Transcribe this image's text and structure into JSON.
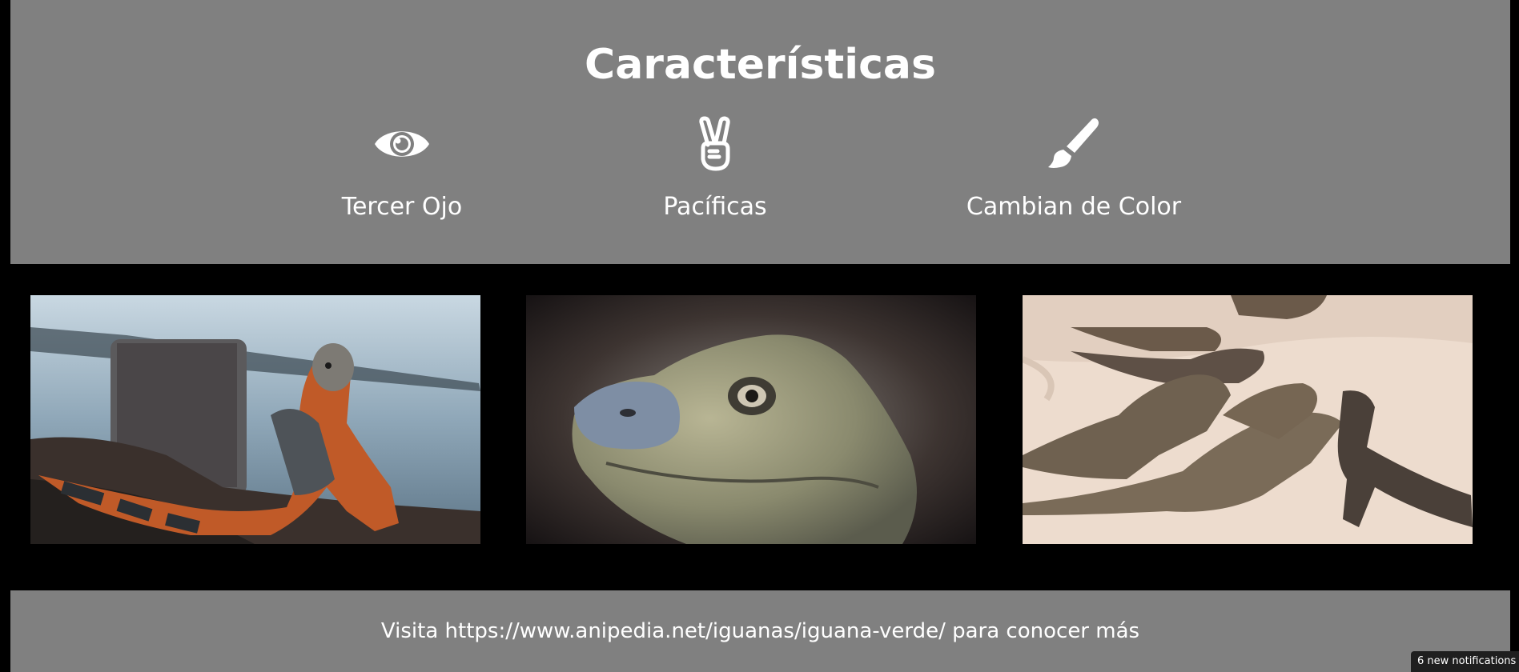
{
  "features": {
    "title": "Características",
    "items": [
      {
        "label": "Tercer Ojo",
        "icon": "eye-icon"
      },
      {
        "label": "Pacíficas",
        "icon": "peace-hand-icon"
      },
      {
        "label": "Cambian de Color",
        "icon": "paint-brush-icon"
      }
    ]
  },
  "gallery": {
    "photos": [
      {
        "subject": "iguana-on-rocks-by-water"
      },
      {
        "subject": "iguana-head-closeup"
      },
      {
        "subject": "iguanas-on-sand"
      }
    ]
  },
  "footer": {
    "text": "Visita https://www.anipedia.net/iguanas/iguana-verde/ para conocer más"
  },
  "notification": {
    "text": "6 new notifications"
  },
  "colors": {
    "page_background": "#000000",
    "panel_background": "#808080",
    "text": "#ffffff"
  }
}
